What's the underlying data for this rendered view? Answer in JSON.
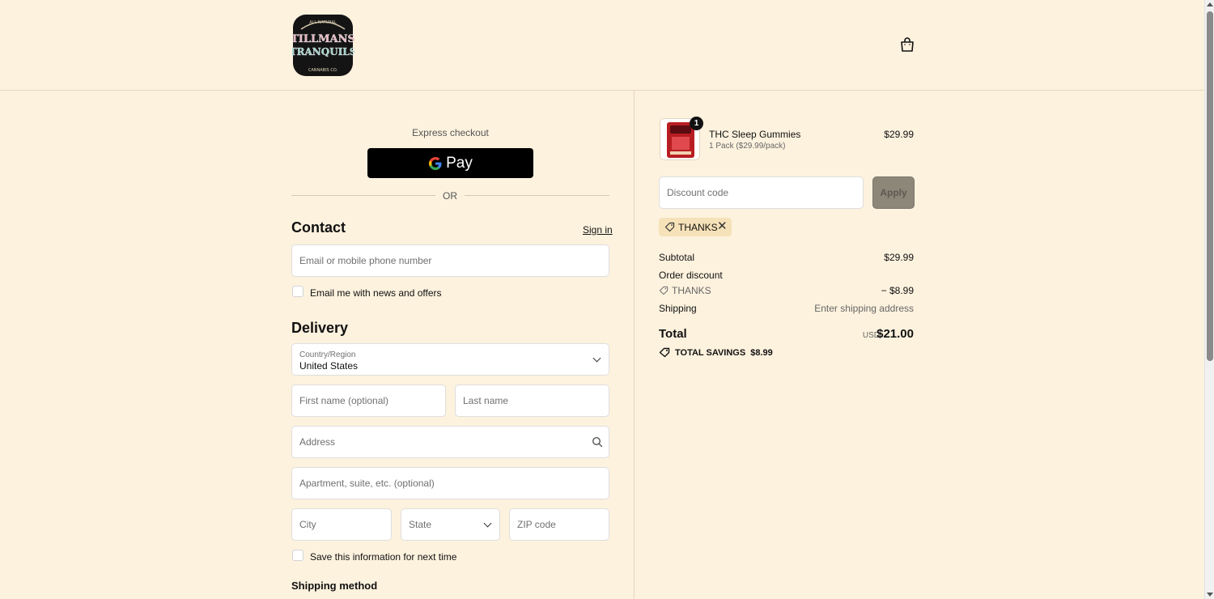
{
  "header": {
    "logo_text": [
      "ALL NATURAL",
      "TILLMANS",
      "TRANQUILS",
      "CANNABIS CO."
    ],
    "cart_icon": "shopping-bag-icon"
  },
  "express": {
    "label": "Express checkout",
    "gpay_label": "Pay",
    "or_label": "OR"
  },
  "contact": {
    "title": "Contact",
    "sign_in": "Sign in",
    "email_placeholder": "Email or mobile phone number",
    "news_label": "Email me with news and offers"
  },
  "delivery": {
    "title": "Delivery",
    "country_label": "Country/Region",
    "country_value": "United States",
    "first_name_placeholder": "First name (optional)",
    "last_name_placeholder": "Last name",
    "address_placeholder": "Address",
    "apartment_placeholder": "Apartment, suite, etc. (optional)",
    "city_placeholder": "City",
    "state_placeholder": "State",
    "zip_placeholder": "ZIP code",
    "save_label": "Save this information for next time"
  },
  "shipping_method": {
    "title": "Shipping method"
  },
  "summary": {
    "product": {
      "name": "THC Sleep Gummies",
      "variant": "1 Pack ($29.99/pack)",
      "price": "$29.99",
      "quantity": "1"
    },
    "discount_placeholder": "Discount code",
    "apply_label": "Apply",
    "applied_code": "THANKS",
    "subtotal_label": "Subtotal",
    "subtotal_value": "$29.99",
    "order_discount_label": "Order discount",
    "discount_code": "THANKS",
    "discount_value": "− $8.99",
    "shipping_label": "Shipping",
    "shipping_value": "Enter shipping address",
    "total_label": "Total",
    "currency": "USD",
    "total_value": "$21.00",
    "savings_label": "TOTAL SAVINGS",
    "savings_value": "$8.99"
  },
  "colors": {
    "background": "#fdf2de",
    "gpay_button": "#000000",
    "apply_button": "#8d877a",
    "discount_chip": "#f6e2b8"
  }
}
